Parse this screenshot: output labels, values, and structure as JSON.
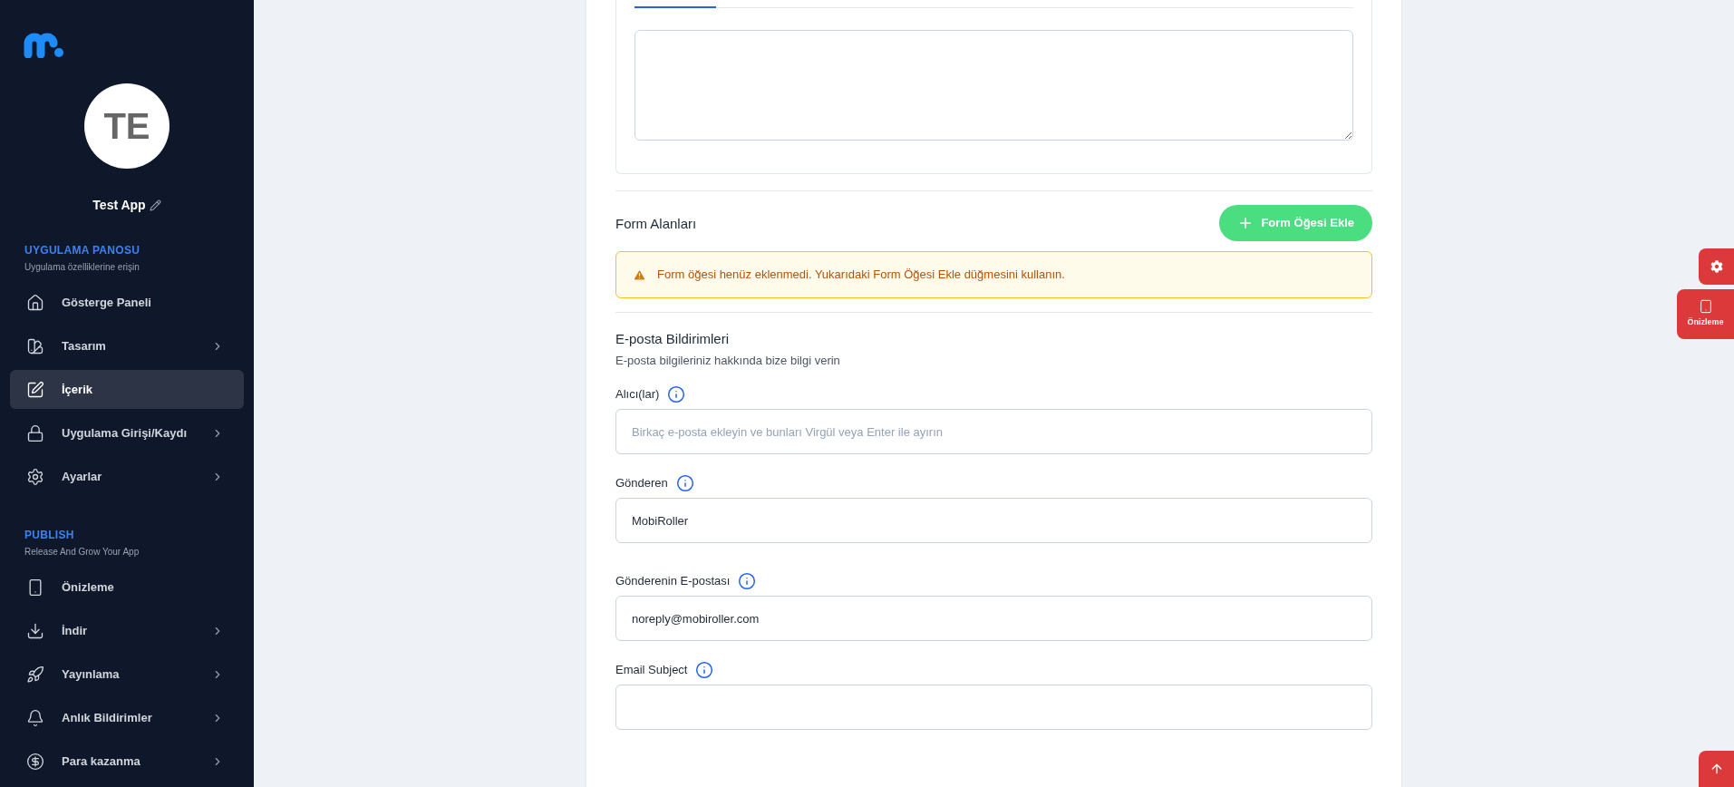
{
  "profile": {
    "initials": "TE",
    "app_name": "Test App"
  },
  "sidebar": {
    "sections": [
      {
        "title": "UYGULAMA PANOSU",
        "subtitle": "Uygulama özelliklerine erişin",
        "items": [
          {
            "label": "Gösterge Paneli",
            "expandable": false,
            "selected": false
          },
          {
            "label": "Tasarım",
            "expandable": true,
            "selected": false
          },
          {
            "label": "İçerik",
            "expandable": false,
            "selected": true
          },
          {
            "label": "Uygulama Girişi/Kaydı",
            "expandable": true,
            "selected": false
          },
          {
            "label": "Ayarlar",
            "expandable": true,
            "selected": false
          }
        ]
      },
      {
        "title": "PUBLISH",
        "subtitle": "Release And Grow Your App",
        "items": [
          {
            "label": "Önizleme",
            "expandable": false,
            "selected": false
          },
          {
            "label": "İndir",
            "expandable": true,
            "selected": false
          },
          {
            "label": "Yayınlama",
            "expandable": true,
            "selected": false
          },
          {
            "label": "Anlık Bildirimler",
            "expandable": true,
            "selected": false
          },
          {
            "label": "Para kazanma",
            "expandable": true,
            "selected": false
          }
        ]
      }
    ]
  },
  "form_fields": {
    "title": "Form Alanları",
    "add_button": "Form Öğesi Ekle",
    "alert": "Form öğesi henüz eklenmedi. Yukarıdaki Form Öğesi Ekle düğmesini kullanın."
  },
  "email_notifications": {
    "title": "E-posta Bildirimleri",
    "subtitle": "E-posta bilgileriniz hakkında bize bilgi verin",
    "fields": [
      {
        "label": "Alıcı(lar)",
        "placeholder": "Birkaç e-posta ekleyin ve bunları Virgül veya Enter ile ayırın"
      },
      {
        "label": "Gönderen",
        "value": "MobiRoller"
      },
      {
        "label": "Gönderenin E-postası",
        "value": "noreply@mobiroller.com"
      },
      {
        "label": "Email Subject"
      }
    ]
  },
  "floating": {
    "preview_button": "Önizleme"
  }
}
